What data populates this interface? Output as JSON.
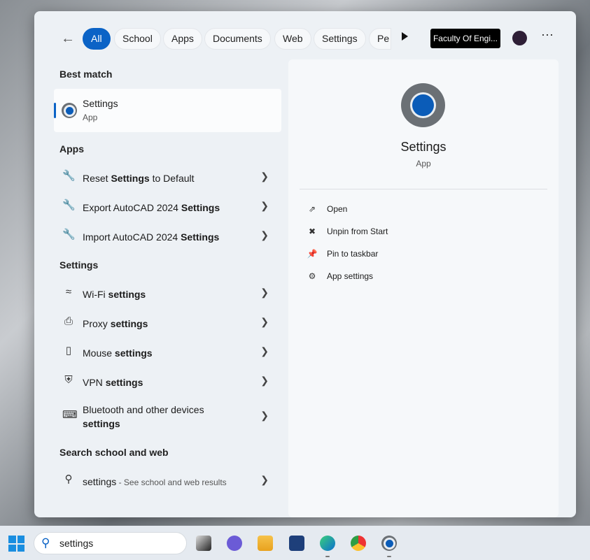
{
  "topbar": {
    "filters": [
      "All",
      "School",
      "Apps",
      "Documents",
      "Web",
      "Settings",
      "Pe"
    ],
    "active": "All",
    "organization": "Faculty Of Engi..."
  },
  "left": {
    "best_match_heading": "Best match",
    "best_match": {
      "title": "Settings",
      "subtitle": "App"
    },
    "apps_heading": "Apps",
    "apps": [
      {
        "pre": "Reset ",
        "bold": "Settings",
        "post": " to Default",
        "icon": "tools-reset-icon"
      },
      {
        "pre": "Export AutoCAD 2024 ",
        "bold": "Settings",
        "post": "",
        "icon": "tools-export-icon"
      },
      {
        "pre": "Import AutoCAD 2024 ",
        "bold": "Settings",
        "post": "",
        "icon": "tools-import-icon"
      }
    ],
    "settings_heading": "Settings",
    "settings": [
      {
        "pre": "Wi-Fi ",
        "bold": "settings",
        "icon": "wifi-icon"
      },
      {
        "pre": "Proxy ",
        "bold": "settings",
        "icon": "proxy-icon"
      },
      {
        "pre": "Mouse ",
        "bold": "settings",
        "icon": "mouse-icon"
      },
      {
        "pre": "VPN ",
        "bold": "settings",
        "icon": "shield-icon"
      },
      {
        "pre": "Bluetooth and other devices",
        "bold": "settings",
        "icon": "bluetooth-devices-icon"
      }
    ],
    "web_heading": "Search school and web",
    "web": {
      "query": "settings",
      "hint": " - See school and web results"
    }
  },
  "right": {
    "title": "Settings",
    "subtitle": "App",
    "actions": [
      "Open",
      "Unpin from Start",
      "Pin to taskbar",
      "App settings"
    ]
  },
  "taskbar": {
    "search_value": "settings"
  },
  "colors": {
    "accent": "#0b63c6"
  }
}
